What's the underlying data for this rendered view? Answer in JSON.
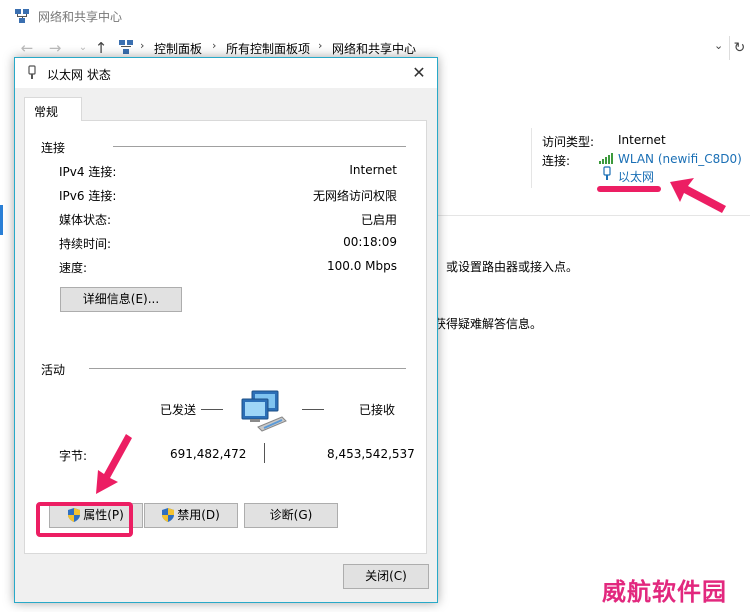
{
  "window": {
    "title": "网络和共享中心",
    "breadcrumb": [
      "控制面板",
      "所有控制面板项",
      "网络和共享中心"
    ]
  },
  "network_info": {
    "access_type_label": "访问类型:",
    "access_type_value": "Internet",
    "connections_label": "连接:",
    "wlan_link": "WLAN (newifi_C8D0)",
    "ethernet_link": "以太网"
  },
  "background_text": {
    "line1": "：或设置路由器或接入点。",
    "line2": "获得疑难解答信息。"
  },
  "dialog": {
    "title": "以太网 状态",
    "tab_general": "常规",
    "connection": {
      "title": "连接",
      "rows": [
        {
          "label": "IPv4 连接:",
          "value": "Internet"
        },
        {
          "label": "IPv6 连接:",
          "value": "无网络访问权限"
        },
        {
          "label": "媒体状态:",
          "value": "已启用"
        },
        {
          "label": "持续时间:",
          "value": "00:18:09"
        },
        {
          "label": "速度:",
          "value": "100.0 Mbps"
        }
      ],
      "details_button": "详细信息(E)..."
    },
    "activity": {
      "title": "活动",
      "sent_label": "已发送",
      "received_label": "已接收",
      "bytes_label": "字节:",
      "bytes_sent": "691,482,472",
      "bytes_received": "8,453,542,537"
    },
    "buttons": {
      "properties": "属性(P)",
      "disable": "禁用(D)",
      "diagnose": "诊断(G)",
      "close": "关闭(C)"
    }
  },
  "watermark": "威航软件园",
  "colors": {
    "accent_border": "#28a9c8",
    "link": "#1a6fb5",
    "annotation": "#ec1e63"
  }
}
